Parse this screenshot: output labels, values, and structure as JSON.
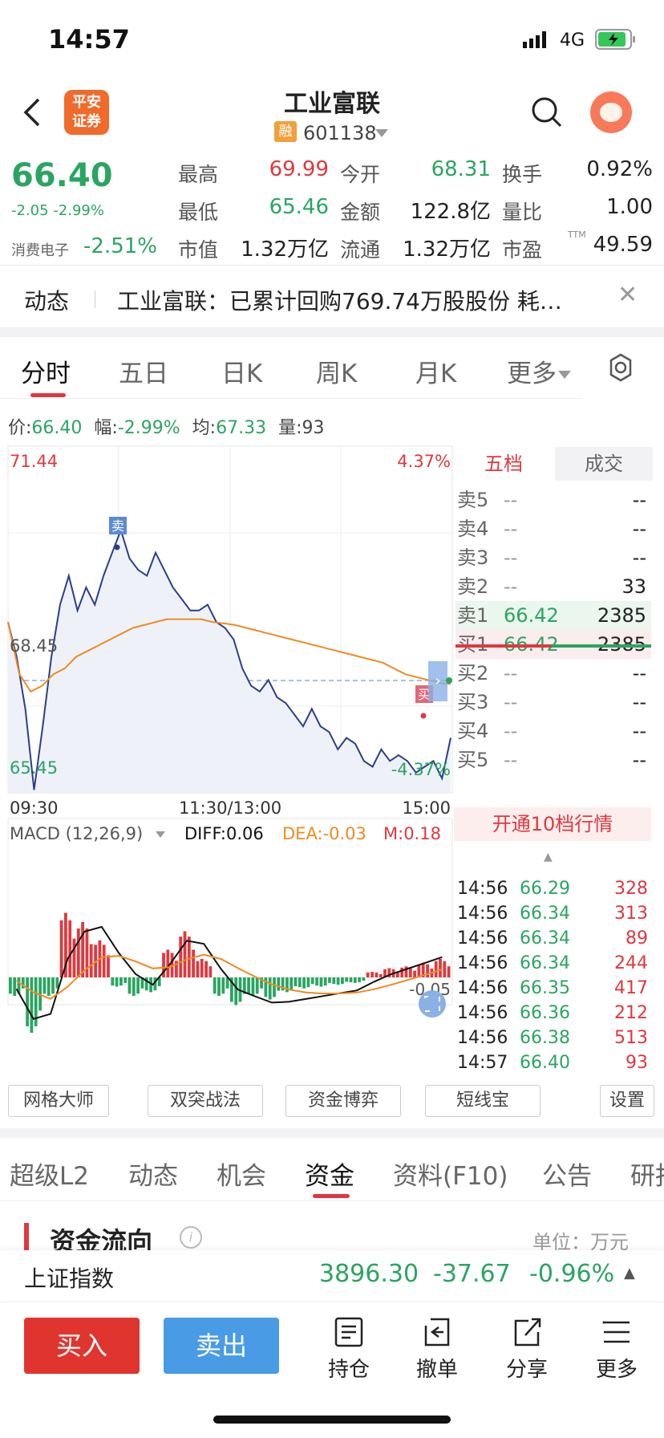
{
  "status": {
    "time": "14:57",
    "network": "4G"
  },
  "header": {
    "title": "工业富联",
    "code": "601138",
    "rong_badge": "融",
    "logo_line1": "平安",
    "logo_line2": "证券"
  },
  "quote": {
    "price": "66.40",
    "change": "-2.05 -2.99%",
    "sector_name": "消费电子",
    "sector_change": "-2.51%",
    "stats": [
      {
        "label": "最高",
        "value": "69.99",
        "color": "#e0383e"
      },
      {
        "label": "今开",
        "value": "68.31",
        "color": "#2aa561"
      },
      {
        "label": "换手",
        "value": "0.92%",
        "color": "#222"
      },
      {
        "label": "最低",
        "value": "65.46",
        "color": "#2aa561"
      },
      {
        "label": "金额",
        "value": "122.8亿",
        "color": "#222"
      },
      {
        "label": "量比",
        "value": "1.00",
        "color": "#222"
      },
      {
        "label": "市值",
        "value": "1.32万亿",
        "color": "#222"
      },
      {
        "label": "流通",
        "value": "1.32万亿",
        "color": "#222"
      },
      {
        "label": "市盈",
        "value": "49.59",
        "color": "#222",
        "sup": "TTM"
      }
    ]
  },
  "news": {
    "label": "动态",
    "text": "工业富联：已累计回购769.74万股股份 耗…"
  },
  "chart_tabs": [
    "分时",
    "五日",
    "日K",
    "周K",
    "月K",
    "更多"
  ],
  "price_info": {
    "price_label": "价:",
    "price": "66.40",
    "amp_label": "幅:",
    "amp": "-2.99%",
    "avg_label": "均:",
    "avg": "67.33",
    "vol_label": "量:",
    "vol": "93"
  },
  "chart_labels": {
    "y_top": "71.44",
    "y_mid": "68.45",
    "y_bot": "65.45",
    "pct_top": "4.37%",
    "pct_bot": "-4.37%",
    "x_start": "09:30",
    "x_mid": "11:30/13:00",
    "x_end": "15:00",
    "sell_marker": "卖",
    "buy_marker": "买",
    "macd_title": "MACD (12,26,9)",
    "diff": "DIFF:0.06",
    "dea": "DEA:-0.03",
    "m": "M:0.18",
    "macd_zero": "-0.05"
  },
  "chart_data": [
    {
      "type": "line",
      "title": "",
      "xlabel": "",
      "ylabel": "",
      "ylim": [
        65.45,
        71.44
      ],
      "x_ticks": [
        "09:30",
        "11:30/13:00",
        "15:00"
      ],
      "series": [
        {
          "values": [
            68.4,
            67.8,
            66.9,
            65.5,
            66.6,
            67.8,
            68.7,
            69.2,
            68.6,
            69.0,
            68.7,
            69.2,
            69.6,
            69.99,
            69.5,
            69.3,
            69.2,
            69.6,
            69.3,
            69.0,
            68.8,
            68.6,
            68.6,
            68.7,
            68.4,
            68.3,
            68.1,
            67.6,
            67.3,
            67.2,
            67.4,
            67.1,
            67.0,
            66.8,
            66.6,
            66.9,
            66.6,
            66.5,
            66.2,
            66.4,
            66.3,
            66.0,
            65.9,
            66.2,
            66.0,
            66.1,
            66.0,
            65.8,
            65.9,
            66.0,
            65.7,
            66.4
          ]
        },
        {
          "values": [
            68.4,
            67.5,
            67.2,
            67.3,
            67.5,
            67.6,
            67.8,
            67.9,
            68.0,
            68.1,
            68.2,
            68.3,
            68.35,
            68.4,
            68.45,
            68.45,
            68.45,
            68.45,
            68.4,
            68.38,
            68.35,
            68.3,
            68.25,
            68.2,
            68.15,
            68.1,
            68.05,
            68.0,
            67.95,
            67.9,
            67.85,
            67.8,
            67.75,
            67.7,
            67.6,
            67.5,
            67.45,
            67.4,
            67.35,
            67.33
          ]
        }
      ]
    },
    {
      "type": "bar",
      "title": "MACD (12,26,9)",
      "values": [
        -0.1,
        -0.3,
        -0.1,
        0.35,
        0.3,
        0.2,
        -0.05,
        -0.1,
        -0.08,
        0.15,
        0.25,
        0.1,
        -0.1,
        -0.15,
        -0.1,
        -0.12,
        -0.08,
        -0.06,
        -0.05,
        -0.04,
        -0.03,
        0.03,
        0.05,
        0.06,
        0.08,
        0.1
      ]
    }
  ],
  "orderbook": {
    "tab_five": "五档",
    "tab_deal": "成交",
    "rows": [
      {
        "label": "卖5",
        "price": "--",
        "vol": "--"
      },
      {
        "label": "卖4",
        "price": "--",
        "vol": "--"
      },
      {
        "label": "卖3",
        "price": "--",
        "vol": "--"
      },
      {
        "label": "卖2",
        "price": "--",
        "vol": "33"
      },
      {
        "label": "卖1",
        "price": "66.42",
        "vol": "2385"
      },
      {
        "label": "买1",
        "price": "66.42",
        "vol": "2385"
      },
      {
        "label": "买2",
        "price": "--",
        "vol": "--"
      },
      {
        "label": "买3",
        "price": "--",
        "vol": "--"
      },
      {
        "label": "买4",
        "price": "--",
        "vol": "--"
      },
      {
        "label": "买5",
        "price": "--",
        "vol": "--"
      }
    ],
    "open10": "开通10档行情"
  },
  "ticks": [
    {
      "time": "14:56",
      "price": "66.29",
      "vol": "328"
    },
    {
      "time": "14:56",
      "price": "66.34",
      "vol": "313"
    },
    {
      "time": "14:56",
      "price": "66.34",
      "vol": "89"
    },
    {
      "time": "14:56",
      "price": "66.34",
      "vol": "244"
    },
    {
      "time": "14:56",
      "price": "66.35",
      "vol": "417"
    },
    {
      "time": "14:56",
      "price": "66.36",
      "vol": "212"
    },
    {
      "time": "14:56",
      "price": "66.38",
      "vol": "513"
    },
    {
      "time": "14:57",
      "price": "66.40",
      "vol": "93"
    }
  ],
  "tools": [
    "网格大师",
    "双突战法",
    "资金博弈",
    "短线宝",
    "设置"
  ],
  "bottom_tabs": [
    "超级L2",
    "动态",
    "机会",
    "资金",
    "资料(F10)",
    "公告",
    "研报"
  ],
  "flow": {
    "title": "资金流向",
    "unit": "单位：万元",
    "info": "i"
  },
  "index": {
    "name": "上证指数",
    "value": "3896.30",
    "change": "-37.67",
    "pct": "-0.96%"
  },
  "actions": {
    "buy": "买入",
    "sell": "卖出",
    "items": [
      "持仓",
      "撤单",
      "分享",
      "更多"
    ]
  },
  "colors": {
    "up": "#e0383e",
    "down": "#2aa561",
    "avg_line": "#f08a20",
    "price_line": "#2a3f8a"
  }
}
